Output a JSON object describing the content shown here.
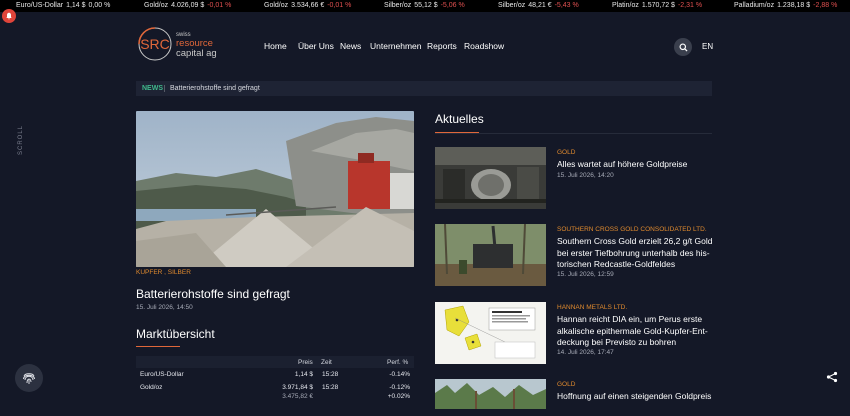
{
  "ticker": [
    {
      "name": "Euro/US-Dollar",
      "value": "1,14 $",
      "change": "0,00 %",
      "dir": "neutral"
    },
    {
      "name": "Gold/oz",
      "value": "4.026,09 $",
      "change": "-0,01 %",
      "dir": "neg"
    },
    {
      "name": "Gold/oz",
      "value": "3.534,66 €",
      "change": "-0,01 %",
      "dir": "neg"
    },
    {
      "name": "Silber/oz",
      "value": "55,12 $",
      "change": "-5,06 %",
      "dir": "neg"
    },
    {
      "name": "Silber/oz",
      "value": "48,21 €",
      "change": "-5,43 %",
      "dir": "neg"
    },
    {
      "name": "Platin/oz",
      "value": "1.570,72 $",
      "change": "-2,31 %",
      "dir": "neg"
    },
    {
      "name": "Palladium/oz",
      "value": "1.238,18 $",
      "change": "-2,88 %",
      "dir": "neg"
    }
  ],
  "logo": {
    "abbr": "SRC",
    "line1": "swiss",
    "line2": "resource",
    "line3": "capital ag"
  },
  "nav": [
    "Home",
    "Über Uns",
    "News",
    "Unternehmen",
    "Reports",
    "Roadshow"
  ],
  "lang": "EN",
  "breadcrumb": {
    "tag": "NEWS",
    "text": "Batterierohstoffe sind gefragt"
  },
  "scroll_label": "SCROLL",
  "hero": {
    "category": "KUPFER , SILBER",
    "title": "Batterierohstoffe sind gefragt",
    "date": "15. Juli 2026, 14:50"
  },
  "market": {
    "title": "Marktübersicht",
    "headers": {
      "price": "Preis",
      "time": "Zeit",
      "perf": "Perf. %"
    },
    "rows": [
      {
        "name": "Euro/US-Dollar",
        "price": "1,14 $",
        "price2": "",
        "time": "15:28",
        "perf": "-0.14%",
        "perf2": ""
      },
      {
        "name": "Gold/oz",
        "price": "3.971,84 $",
        "price2": "3.475,82 €",
        "time": "15:28",
        "perf": "-0.12%",
        "perf2": "+0.02%"
      }
    ]
  },
  "aktuelles": {
    "title": "Aktuelles",
    "articles": [
      {
        "category": "GOLD",
        "title": "Alles wartet auf höhere Goldpreise",
        "date": "15. Juli 2026, 14:20"
      },
      {
        "category": "SOUTHERN CROSS GOLD CONSOLIDATED LTD.",
        "title": "Southern Cross Gold erzielt 26,2 g/t Gold bei erster Tiefbohrung unterhalb des his­torischen Redcastle-Goldfeldes",
        "date": "15. Juli 2026, 12:59"
      },
      {
        "category": "HANNAN METALS LTD.",
        "title": "Hannan reicht DIA ein, um Perus erste alkalische epithermale Gold-Kupfer-Ent­deckung bei Previsto zu bohren",
        "date": "14. Juli 2026, 17:47"
      },
      {
        "category": "GOLD",
        "title": "Hoffnung auf einen steigenden Goldpreis",
        "date": ""
      }
    ]
  },
  "colors": {
    "accent": "#e0673a",
    "category": "#e08a2e",
    "news_tag": "#3fb98b",
    "negative": "#e05050",
    "positive": "#3fb950",
    "background": "#141827"
  }
}
